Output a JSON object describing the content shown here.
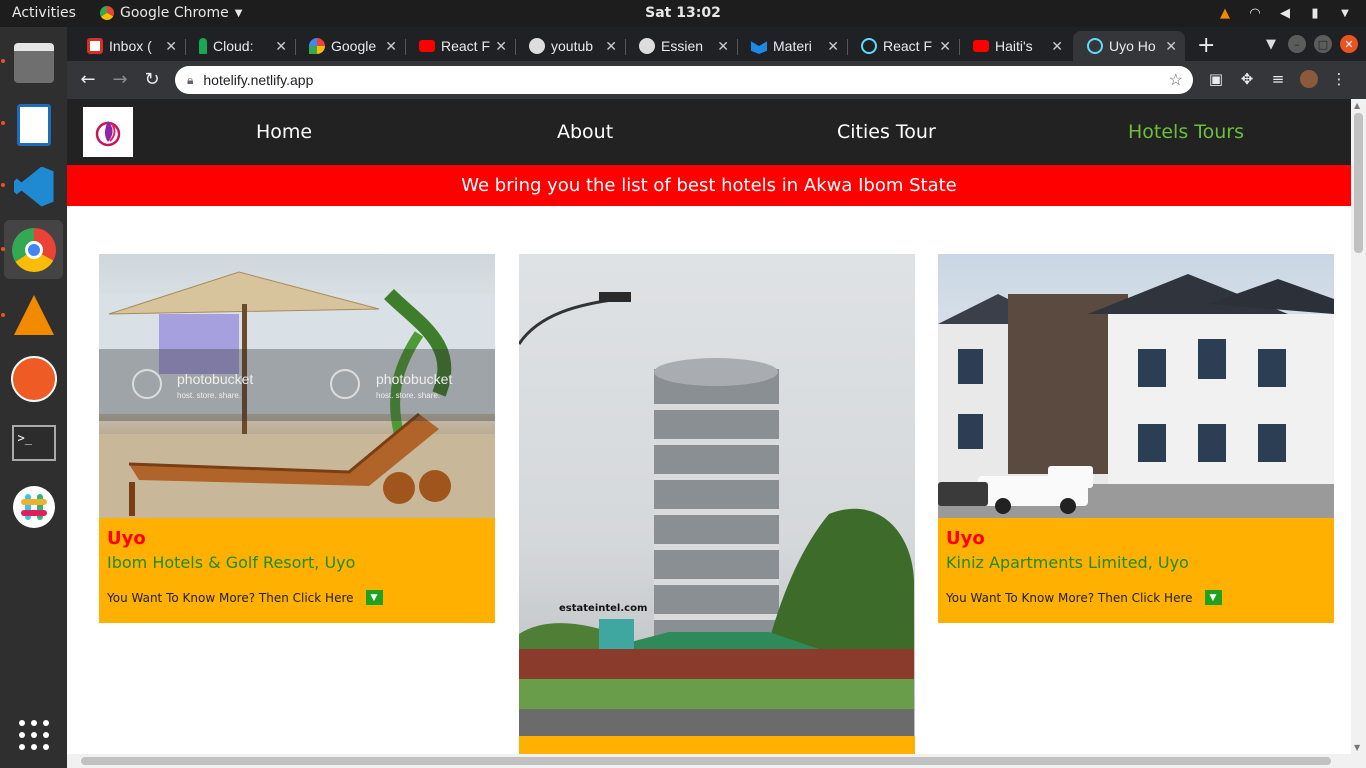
{
  "desktop": {
    "activities_label": "Activities",
    "app_name": "Google Chrome",
    "clock": "Sat 13:02"
  },
  "browser": {
    "tabs": [
      {
        "title": "Inbox (",
        "icon": "gmail-icon",
        "color": "#d93025"
      },
      {
        "title": "Cloud:",
        "icon": "mongodb-icon",
        "color": "#13aa52"
      },
      {
        "title": "Google",
        "icon": "google-maps-icon",
        "color": "#4285f4"
      },
      {
        "title": "React F",
        "icon": "youtube-icon",
        "color": "#ff0000"
      },
      {
        "title": "youtub",
        "icon": "github-icon",
        "color": "#cccccc"
      },
      {
        "title": "Essien",
        "icon": "github-icon",
        "color": "#cccccc"
      },
      {
        "title": "Materi",
        "icon": "material-ui-icon",
        "color": "#1e88e5"
      },
      {
        "title": "React F",
        "icon": "react-icon",
        "color": "#61dafb"
      },
      {
        "title": "Haiti's",
        "icon": "youtube-icon",
        "color": "#ff0000"
      },
      {
        "title": "Uyo Ho",
        "icon": "react-icon",
        "color": "#61dafb",
        "active": true
      }
    ],
    "url": "hotelify.netlify.app"
  },
  "site": {
    "nav": {
      "home": "Home",
      "about": "About",
      "cities_tour": "Cities Tour",
      "hotels_tours": "Hotels Tours"
    },
    "banner": "We bring you the list of best hotels in Akwa Ibom State",
    "more_label": "You Want To Know More? Then Click Here",
    "cards": [
      {
        "city": "Uyo",
        "hotel": "Ibom Hotels & Golf Resort, Uyo",
        "more": "You Want To Know More? Then Click Here"
      },
      {
        "watermark": "estateintel.com"
      },
      {
        "city": "Uyo",
        "hotel": "Kiniz Apartments Limited, Uyo",
        "more": "You Want To Know More? Then Click Here"
      }
    ],
    "photobucket_text": "photobucket",
    "photobucket_sub": "host. store. share."
  },
  "colors": {
    "banner": "#ff0000",
    "card_bg": "#ffb000",
    "city": "#ff0000",
    "hotel": "#1e8c1e",
    "nav_active": "#6bbf3a"
  }
}
